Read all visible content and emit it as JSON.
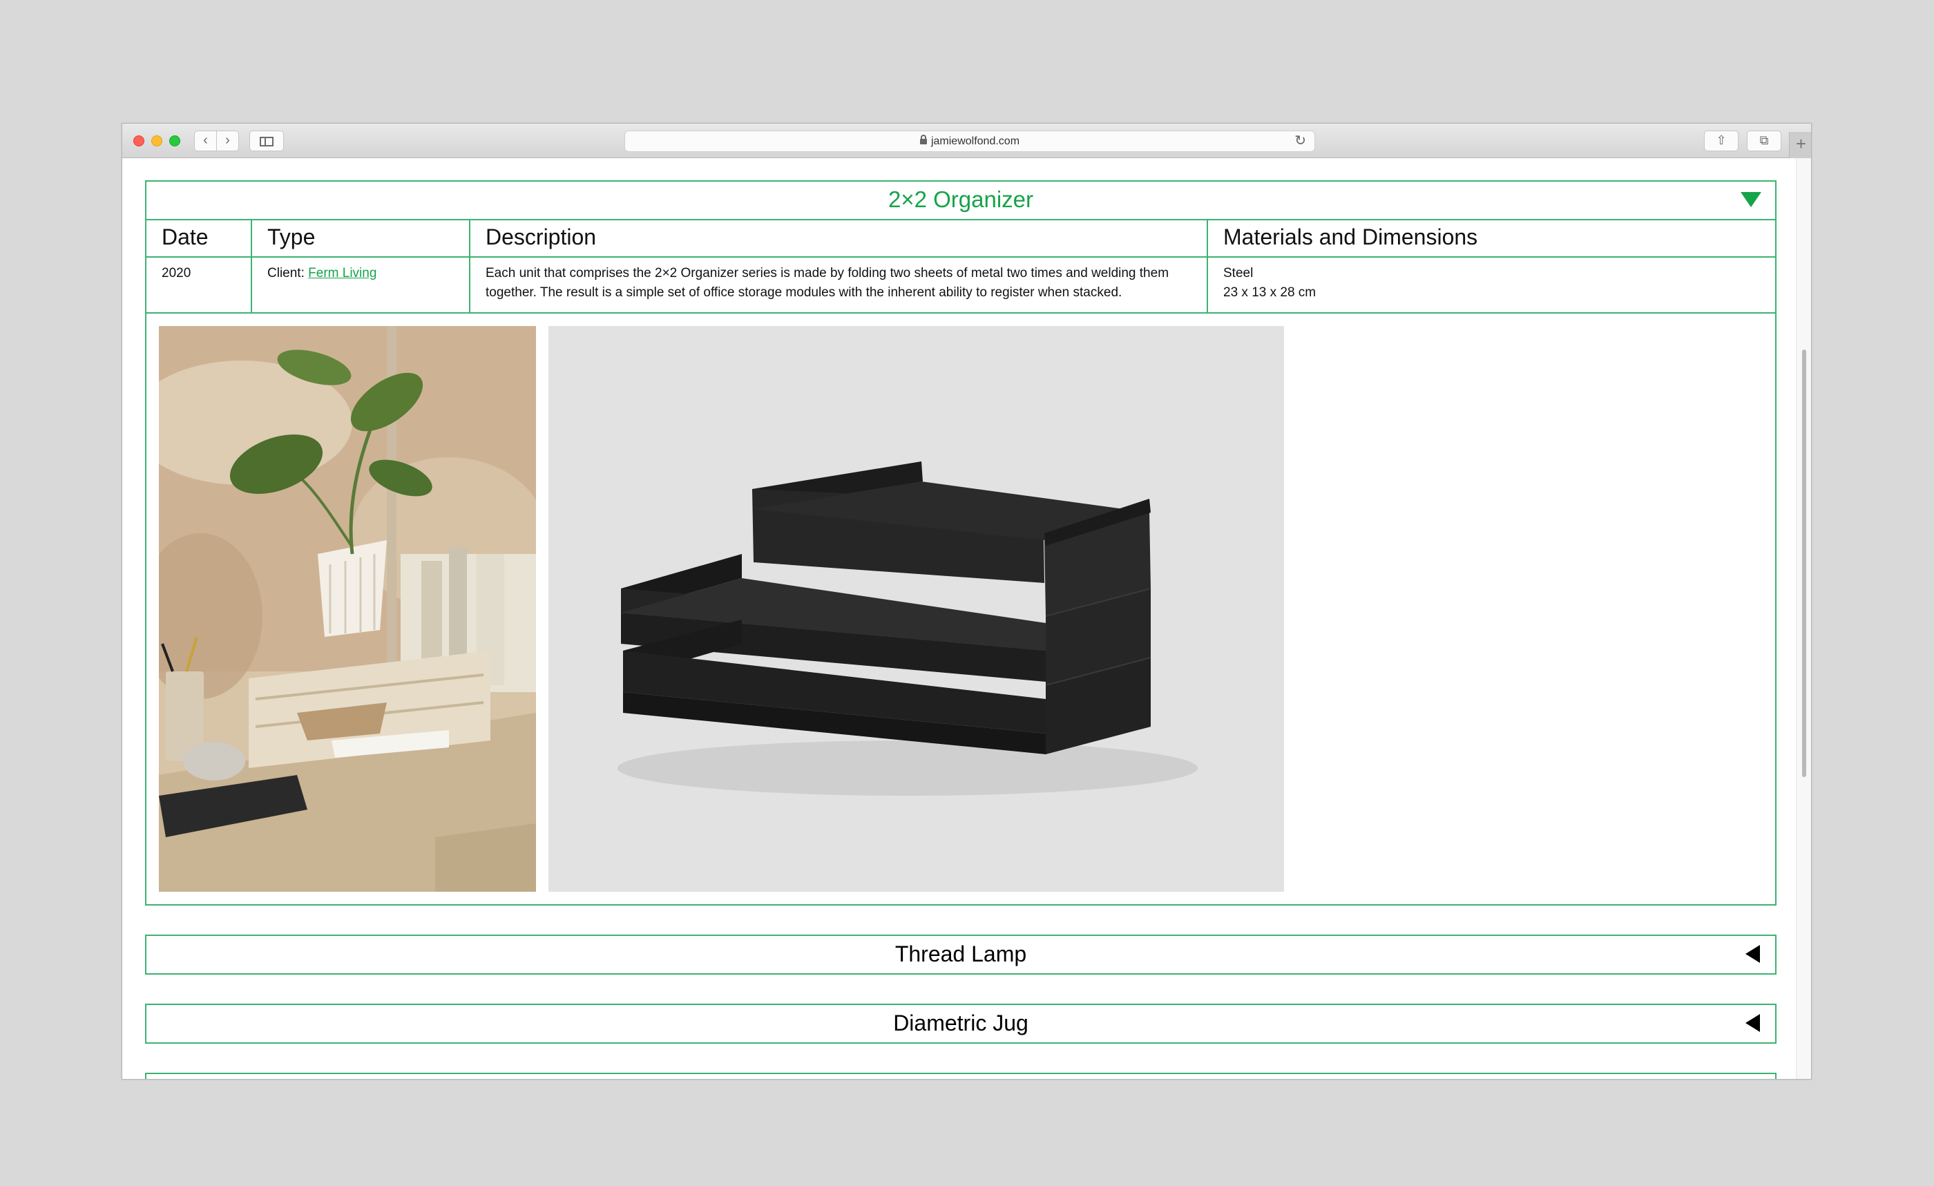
{
  "browser": {
    "url": "jamiewolfond.com",
    "back_glyph": "‹",
    "forward_glyph": "›",
    "reload_glyph": "↻",
    "share_glyph": "⇧",
    "tabs_glyph": "⧉",
    "newtab_glyph": "+"
  },
  "projects": [
    {
      "title": "2×2 Organizer",
      "expanded": true,
      "columns": [
        "Date",
        "Type",
        "Description",
        "Materials and Dimensions"
      ],
      "date": "2020",
      "type_prefix": "Client: ",
      "client": "Ferm Living",
      "description": "Each unit that comprises the 2×2 Organizer series is made by folding two sheets of metal two times and welding them together. The result is a simple set of office storage modules with the inherent ability to register when stacked.",
      "material": "Steel",
      "dimensions": "23 x 13 x 28 cm"
    },
    {
      "title": "Thread Lamp",
      "expanded": false
    },
    {
      "title": "Diametric Jug",
      "expanded": false
    }
  ],
  "colors": {
    "accent": "#17a34a",
    "border": "#3cb371"
  },
  "icons": {
    "expanded": "triangle-down-icon",
    "collapsed": "triangle-left-icon"
  }
}
